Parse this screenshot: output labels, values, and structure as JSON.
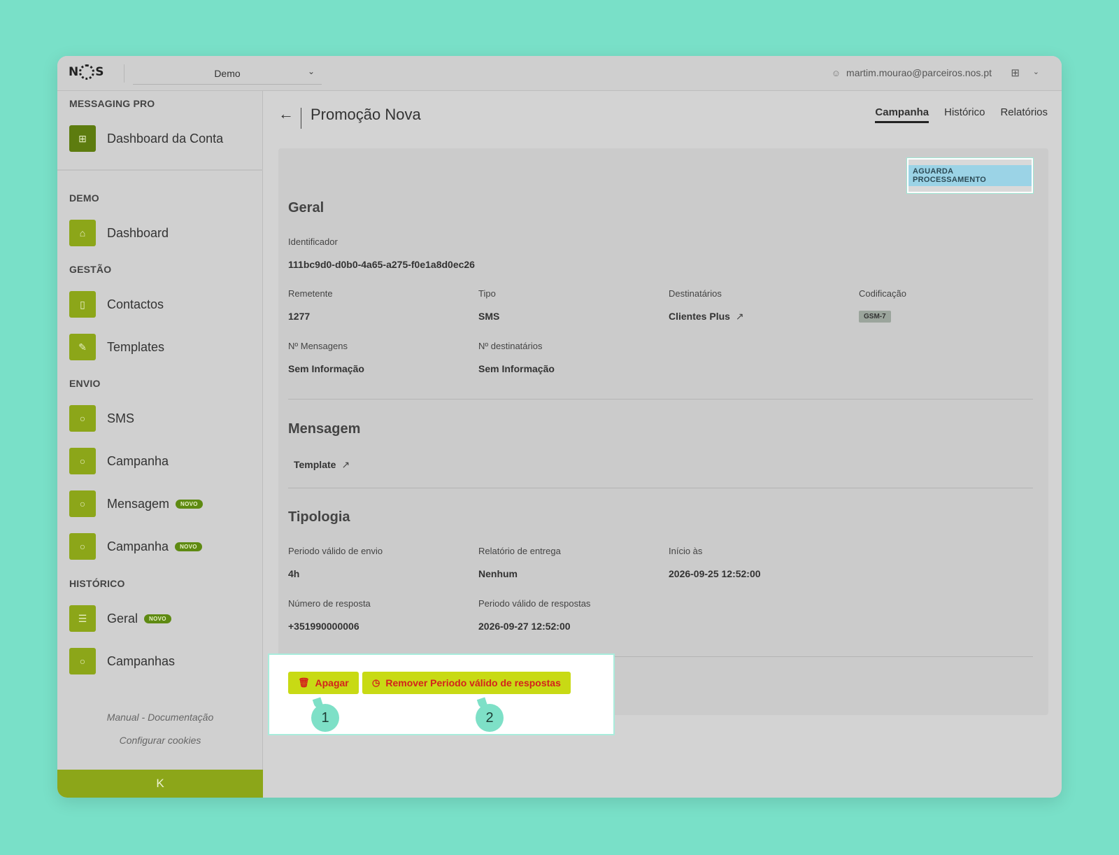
{
  "topbar": {
    "logo_left": "N",
    "logo_right": "S",
    "org_select": "Demo",
    "user_email": "martim.mourao@parceiros.nos.pt"
  },
  "sidebar": {
    "sections": {
      "messaging_pro": "MESSAGING PRO",
      "demo": "DEMO",
      "gestao": "GESTÃO",
      "envio": "ENVIO",
      "historico": "HISTÓRICO"
    },
    "items": {
      "dashboard_conta": "Dashboard da Conta",
      "dashboard": "Dashboard",
      "contactos": "Contactos",
      "templates": "Templates",
      "sms": "SMS",
      "campanha": "Campanha",
      "mensagem": "Mensagem",
      "campanha_novo": "Campanha",
      "geral": "Geral",
      "campanhas": "Campanhas"
    },
    "badge_novo": "NOVO",
    "footer": {
      "manual": "Manual - Documentação",
      "cookies": "Configurar cookies"
    },
    "collapse_glyph": "K"
  },
  "page": {
    "title": "Promoção Nova",
    "tabs": [
      "Campanha",
      "Histórico",
      "Relatórios"
    ],
    "status": "AGUARDA PROCESSAMENTO"
  },
  "geral": {
    "heading": "Geral",
    "identificador_label": "Identificador",
    "identificador_value": "111bc9d0-d0b0-4a65-a275-f0e1a8d0ec26",
    "remetente_label": "Remetente",
    "remetente_value": "1277",
    "tipo_label": "Tipo",
    "tipo_value": "SMS",
    "destinatarios_label": "Destinatários",
    "destinatarios_value": "Clientes Plus",
    "codificacao_label": "Codificação",
    "codificacao_value": "GSM-7",
    "n_mensagens_label": "Nº Mensagens",
    "n_mensagens_value": "Sem Informação",
    "n_destinatarios_label": "Nº destinatários",
    "n_destinatarios_value": "Sem Informação"
  },
  "mensagem": {
    "heading": "Mensagem",
    "template_link": "Template"
  },
  "tipologia": {
    "heading": "Tipologia",
    "periodo_envio_label": "Periodo válido de envio",
    "periodo_envio_value": "4h",
    "relatorio_label": "Relatório de entrega",
    "relatorio_value": "Nenhum",
    "inicio_label": "Início às",
    "inicio_value": "2026-09-25 12:52:00",
    "numero_resposta_label": "Número de resposta",
    "numero_resposta_value": "+351990000006",
    "periodo_respostas_label": "Periodo válido de respostas",
    "periodo_respostas_value": "2026-09-27 12:52:00"
  },
  "actions": {
    "apagar": "Apagar",
    "remover": "Remover Periodo válido de respostas"
  },
  "markers": [
    "1",
    "2"
  ],
  "colors": {
    "background": "#79e0c8",
    "accent_green": "#8ca619",
    "button_yellow": "#c8da14",
    "button_text_red": "#d3231c",
    "status_badge": "#9bd3e6",
    "marker": "#7ee0c7"
  }
}
